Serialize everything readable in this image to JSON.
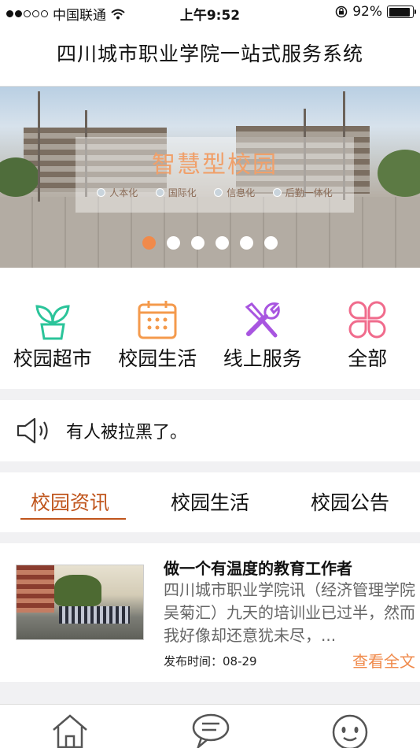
{
  "status_bar": {
    "carrier": "中国联通",
    "time": "上午9:52",
    "battery_percent": "92%",
    "battery_level": 0.92,
    "signal_bars_filled": 2,
    "signal_bars_total": 5
  },
  "header": {
    "title": "四川城市职业学院一站式服务系统"
  },
  "banner": {
    "overlay_title": "智慧型校园",
    "tags": [
      "人本化",
      "国际化",
      "信息化",
      "后勤一体化"
    ],
    "slide_count": 6,
    "active_slide": 1
  },
  "quick_actions": [
    {
      "label": "校园超市",
      "icon": "plant-icon",
      "color": "#2bc49a"
    },
    {
      "label": "校园生活",
      "icon": "calendar-icon",
      "color": "#f49a4c"
    },
    {
      "label": "线上服务",
      "icon": "tools-icon",
      "color": "#a855e0"
    },
    {
      "label": "全部",
      "icon": "clover-icon",
      "color": "#f06b8c"
    }
  ],
  "notice": {
    "text": "有人被拉黑了。",
    "icon": "speaker-icon"
  },
  "tabs": [
    {
      "label": "校园资讯",
      "active": true
    },
    {
      "label": "校园生活",
      "active": false
    },
    {
      "label": "校园公告",
      "active": false
    }
  ],
  "news": [
    {
      "title": "做一个有温度的教育工作者",
      "summary": "四川城市职业学院讯（经济管理学院 吴菊汇）九天的培训业已过半，然而我好像却还意犹未尽，...",
      "date_label": "发布时间：",
      "date": "08-29",
      "read_more": "查看全文"
    }
  ],
  "bottom_nav": [
    {
      "icon": "home-icon"
    },
    {
      "icon": "message-icon"
    },
    {
      "icon": "profile-face-icon"
    }
  ],
  "colors": {
    "accent": "#c0551c",
    "orange": "#f08a4b",
    "summary_gray": "#666666"
  }
}
